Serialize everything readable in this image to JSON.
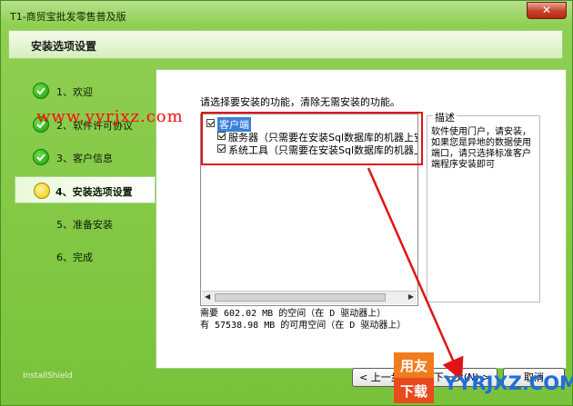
{
  "window": {
    "title": "T1-商贸宝批发零售普及版",
    "close_symbol": "✕"
  },
  "header": {
    "title": "安装选项设置"
  },
  "steps": [
    {
      "label": "1、欢迎",
      "state": "done"
    },
    {
      "label": "2、软件许可协议",
      "state": "done"
    },
    {
      "label": "3、客户信息",
      "state": "done"
    },
    {
      "label": "4、安装选项设置",
      "state": "active"
    },
    {
      "label": "5、准备安装",
      "state": "pending"
    },
    {
      "label": "6、完成",
      "state": "pending"
    }
  ],
  "content": {
    "prompt": "请选择要安装的功能，清除无需安装的功能。",
    "tree": [
      {
        "label": "客户端",
        "checked": true,
        "level": 0
      },
      {
        "label": "服务器（只需要在安装Sql数据库的机器上安装",
        "checked": true,
        "level": 1
      },
      {
        "label": "系统工具（只需要在安装Sql数据库的机器上安",
        "checked": true,
        "level": 1
      }
    ],
    "description": {
      "legend": "描述",
      "text": "软件使用门户，请安装，如果您是异地的数据使用端口，请只选择标准客户端程序安装即可"
    },
    "space_required": "需要 602.02 MB 的空间（在 D 驱动器上）",
    "space_available": "有 57538.98 MB 的可用空间（在 D 驱动器上）"
  },
  "footer": {
    "brand": "InstallShield",
    "back_label": "< 上一步(B)",
    "next_label": "下一步(N) >",
    "cancel_label": "取消"
  },
  "watermark": {
    "site": "www.yyrjxz.com",
    "logo_text_top": "用友",
    "logo_text_bottom": "下载",
    "logo_domain": "YYRJXZ.COM"
  },
  "colors": {
    "annotation": "#e01414",
    "window_green": "#79c23a",
    "selection": "#3b7fd8"
  }
}
